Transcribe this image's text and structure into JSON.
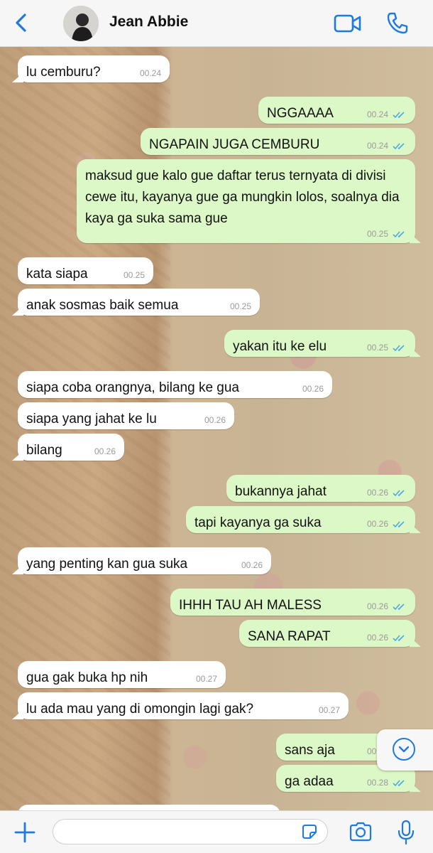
{
  "header": {
    "contact_name": "Jean Abbie",
    "icons": {
      "back": "chevron-left-icon",
      "video": "video-call-icon",
      "call": "phone-icon"
    }
  },
  "colors": {
    "accent": "#1f7ae0",
    "outgoing_bubble": "#dcf8c6",
    "incoming_bubble": "#ffffff",
    "read_tick": "#4aa8e8"
  },
  "messages": [
    {
      "dir": "in",
      "text": "lu cemburu?",
      "time": "00.24"
    },
    {
      "dir": "out",
      "text": "NGGAAAA",
      "time": "00.24"
    },
    {
      "dir": "out",
      "text": "NGAPAIN JUGA CEMBURU",
      "time": "00.24"
    },
    {
      "dir": "out",
      "text": "maksud gue kalo gue daftar terus ternyata di divisi cewe itu, kayanya gue ga mungkin lolos, soalnya dia kaya ga suka sama gue",
      "time": "00.25"
    },
    {
      "dir": "in",
      "text": "kata siapa",
      "time": "00.25"
    },
    {
      "dir": "in",
      "text": "anak sosmas baik semua",
      "time": "00.25"
    },
    {
      "dir": "out",
      "text": "yakan itu ke elu",
      "time": "00.25"
    },
    {
      "dir": "in",
      "text": "siapa coba orangnya, bilang ke gua",
      "time": "00.26"
    },
    {
      "dir": "in",
      "text": "siapa yang jahat ke lu",
      "time": "00.26"
    },
    {
      "dir": "in",
      "text": "bilang",
      "time": "00.26"
    },
    {
      "dir": "out",
      "text": "bukannya jahat",
      "time": "00.26"
    },
    {
      "dir": "out",
      "text": "tapi kayanya ga suka",
      "time": "00.26"
    },
    {
      "dir": "in",
      "text": "yang penting kan gua suka",
      "time": "00.26"
    },
    {
      "dir": "out",
      "text": "IHHH TAU AH MALESS",
      "time": "00.26"
    },
    {
      "dir": "out",
      "text": "SANA RAPAT",
      "time": "00.26"
    },
    {
      "dir": "in",
      "text": "gua gak buka hp nih",
      "time": "00.27"
    },
    {
      "dir": "in",
      "text": "lu ada mau yang di omongin lagi gak?",
      "time": "00.27"
    },
    {
      "dir": "out",
      "text": "sans aja",
      "time": "00.28"
    },
    {
      "dir": "out",
      "text": "ga adaa",
      "time": "00.28"
    }
  ],
  "composer": {
    "placeholder": ""
  }
}
